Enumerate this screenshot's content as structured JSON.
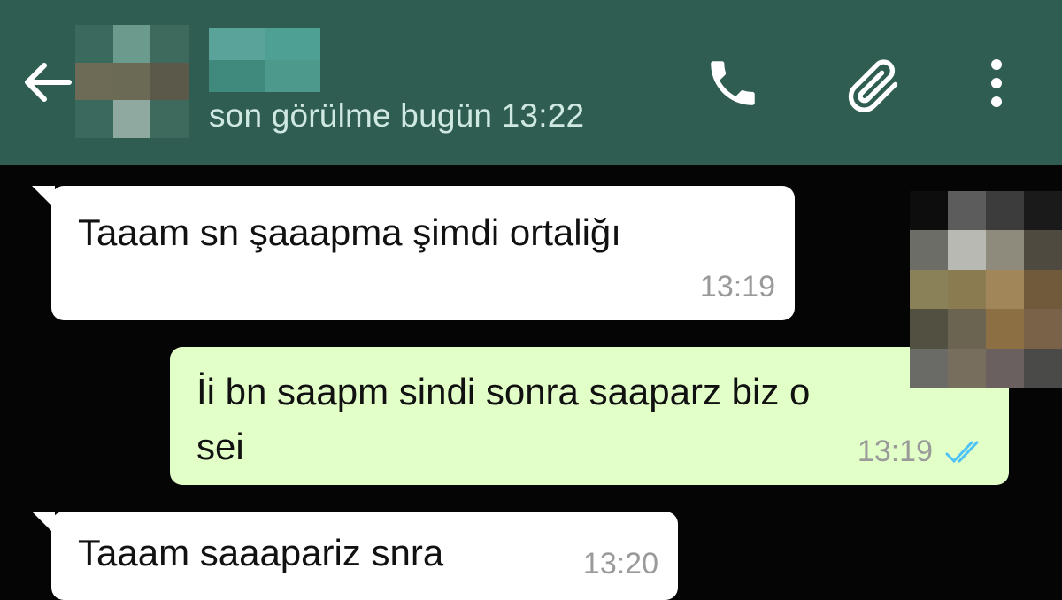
{
  "header": {
    "last_seen": "son görülme bugün 13:22",
    "icons": [
      "back-arrow-icon",
      "phone-icon",
      "paperclip-icon",
      "more-vert-icon"
    ],
    "bg_color": "#2f5d52"
  },
  "messages": [
    {
      "direction": "incoming",
      "text": "Taaam sn şaaapma şimdi ortaliğı",
      "time": "13:19"
    },
    {
      "direction": "outgoing",
      "text": "İi bn saapm sindi sonra saaparz biz o\nsei",
      "time": "13:19",
      "status": "read",
      "status_icon": "double-check-icon"
    },
    {
      "direction": "incoming",
      "text": "Taaam saaapariz snra",
      "time": "13:20"
    }
  ],
  "colors": {
    "chat_bg": "#050505",
    "incoming_bubble": "#ffffff",
    "outgoing_bubble": "#e2ffc8",
    "read_tick": "#4fc3f7"
  }
}
